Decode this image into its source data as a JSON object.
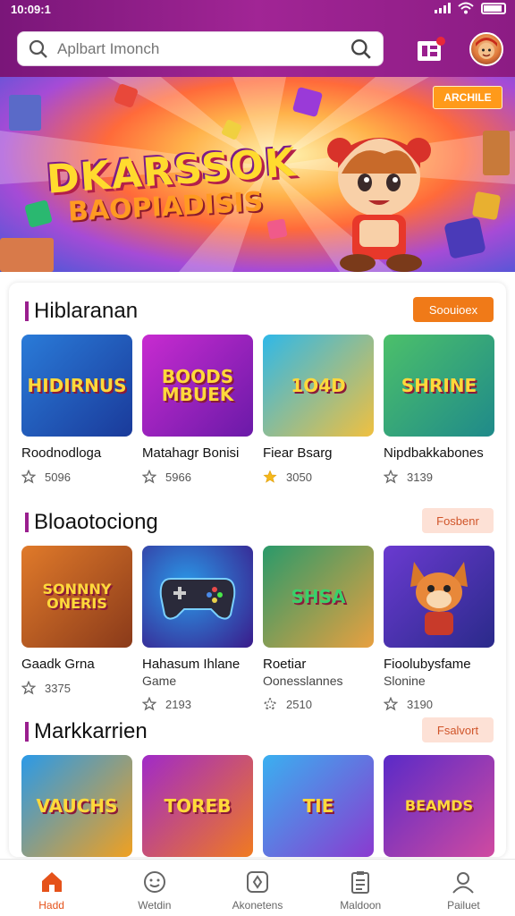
{
  "status": {
    "time": "10:09:1"
  },
  "search": {
    "placeholder": "Aplbart Imonch"
  },
  "banner": {
    "title_line1": "DKARSSOK",
    "title_line2": "BAOPIADISIS",
    "badge": "ARCHILE"
  },
  "sections": [
    {
      "title": "Hiblaranan",
      "button": "Soouioex",
      "games": [
        {
          "art": "HIDIRNUS",
          "name": "Roodnodloga",
          "sub": "",
          "rating": "5096",
          "icon": "star-outline-icon",
          "colors": [
            "#2a7bd8",
            "#1a3a9a"
          ]
        },
        {
          "art": "BOODS\nMBUEK",
          "name": "Matahagr Bonisi",
          "sub": "",
          "rating": "5966",
          "icon": "star-outline-icon",
          "colors": [
            "#c82bd0",
            "#6a1aa8"
          ]
        },
        {
          "art": "1O4D",
          "name": "Fiear Bsarg",
          "sub": "",
          "rating": "3050",
          "icon": "star-filled-icon",
          "colors": [
            "#2fb8e8",
            "#f0c040"
          ]
        },
        {
          "art": "SHRINE",
          "name": "Nipdbakkabones",
          "sub": "",
          "rating": "3139",
          "icon": "star-outline-icon",
          "colors": [
            "#4cc06a",
            "#1f8a8a"
          ]
        }
      ]
    },
    {
      "title": "Bloaotociong",
      "button": "Fosbenr",
      "games": [
        {
          "art": "SONNNY\nONERIS",
          "name": "Gaadk Grna",
          "sub": "",
          "rating": "3375",
          "icon": "star-outline-icon",
          "colors": [
            "#e07a2a",
            "#8a3a1a"
          ]
        },
        {
          "art": "",
          "name": "Hahasum Ihlane",
          "sub": "Game",
          "rating": "2193",
          "icon": "star-outline-icon",
          "colors": [
            "#3a2a8a",
            "#1a8ac8"
          ]
        },
        {
          "art": "SHSA",
          "name": "Roetiar",
          "sub": "Oonesslannes",
          "rating": "2510",
          "icon": "star-half-icon",
          "colors": [
            "#2a9a6a",
            "#e8a040"
          ]
        },
        {
          "art": "",
          "name": "Fioolubysfame",
          "sub": "Slonine",
          "rating": "3190",
          "icon": "star-outline-icon",
          "colors": [
            "#6a3ad0",
            "#2a2a8a"
          ]
        }
      ]
    },
    {
      "title": "Markkarrien",
      "button": "Fsalvort",
      "games": [
        {
          "art": "VAUCHS",
          "name": "",
          "sub": "",
          "rating": "",
          "icon": "",
          "colors": [
            "#2a9ae8",
            "#f0a020"
          ]
        },
        {
          "art": "TOREB",
          "name": "",
          "sub": "",
          "rating": "",
          "icon": "",
          "colors": [
            "#a02ac8",
            "#f07a20"
          ]
        },
        {
          "art": "TIE",
          "name": "",
          "sub": "",
          "rating": "",
          "icon": "",
          "colors": [
            "#3ab0f0",
            "#8a3ad0"
          ]
        },
        {
          "art": "BEAMDS",
          "name": "",
          "sub": "",
          "rating": "",
          "icon": "",
          "colors": [
            "#5a2ac8",
            "#d04aa0"
          ]
        }
      ]
    }
  ],
  "nav": [
    {
      "label": "Hadd",
      "icon": "home-icon",
      "active": true
    },
    {
      "label": "Wetdin",
      "icon": "face-icon",
      "active": false
    },
    {
      "label": "Akonetens",
      "icon": "compass-icon",
      "active": false
    },
    {
      "label": "Maldoon",
      "icon": "clipboard-icon",
      "active": false
    },
    {
      "label": "Pailuet",
      "icon": "profile-icon",
      "active": false
    }
  ],
  "colors": {
    "header": "#8c1c84",
    "accent": "#f07a18",
    "active_nav": "#e5521a"
  }
}
